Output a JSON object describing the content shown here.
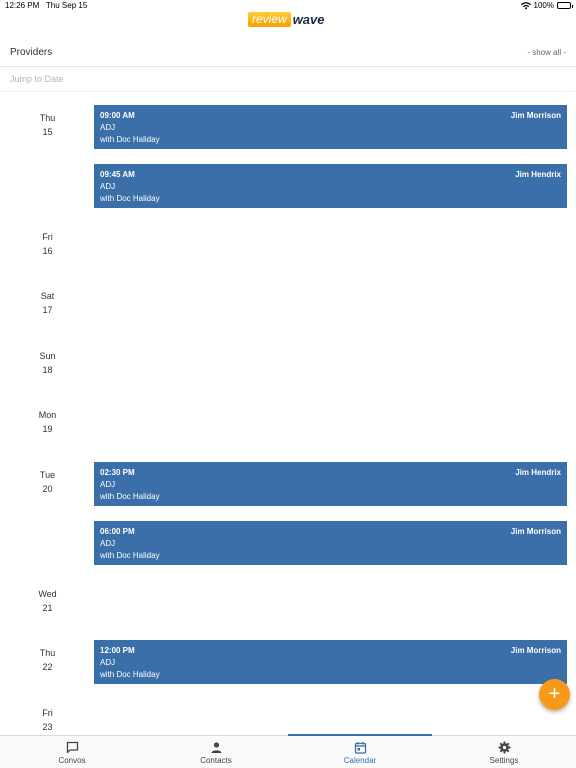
{
  "status_bar": {
    "time": "12:26 PM",
    "date": "Thu Sep 15",
    "battery": "100%"
  },
  "logo": {
    "part1": "review",
    "part2": "wave"
  },
  "providers": {
    "label": "Providers",
    "show_all": "- show all -"
  },
  "jump": {
    "placeholder": "Jump to Date"
  },
  "days": [
    {
      "dow": "Thu",
      "num": "15"
    },
    {
      "dow": "Fri",
      "num": "16"
    },
    {
      "dow": "Sat",
      "num": "17"
    },
    {
      "dow": "Sun",
      "num": "18"
    },
    {
      "dow": "Mon",
      "num": "19"
    },
    {
      "dow": "Tue",
      "num": "20"
    },
    {
      "dow": "Wed",
      "num": "21"
    },
    {
      "dow": "Thu",
      "num": "22"
    },
    {
      "dow": "Fri",
      "num": "23"
    }
  ],
  "appointments": [
    {
      "time": "09:00 AM",
      "provider": "Jim Morrison",
      "type": "ADJ",
      "with": "with Doc Haliday"
    },
    {
      "time": "09:45 AM",
      "provider": "Jim Hendrix",
      "type": "ADJ",
      "with": "with Doc Haliday"
    },
    {
      "time": "02:30 PM",
      "provider": "Jim Hendrix",
      "type": "ADJ",
      "with": "with Doc Haliday"
    },
    {
      "time": "06:00 PM",
      "provider": "Jim Morrison",
      "type": "ADJ",
      "with": "with Doc Haliday"
    },
    {
      "time": "12:00 PM",
      "provider": "Jim Morrison",
      "type": "ADJ",
      "with": "with Doc Haliday"
    }
  ],
  "fab": {
    "label": "+"
  },
  "tabs": [
    {
      "label": "Convos",
      "icon": "chat-icon"
    },
    {
      "label": "Contacts",
      "icon": "person-icon"
    },
    {
      "label": "Calendar",
      "icon": "calendar-icon"
    },
    {
      "label": "Settings",
      "icon": "gear-icon"
    }
  ],
  "colors": {
    "accent": "#3a6faa",
    "fab": "#f79a1a",
    "logo_orange": "#f5a200"
  }
}
